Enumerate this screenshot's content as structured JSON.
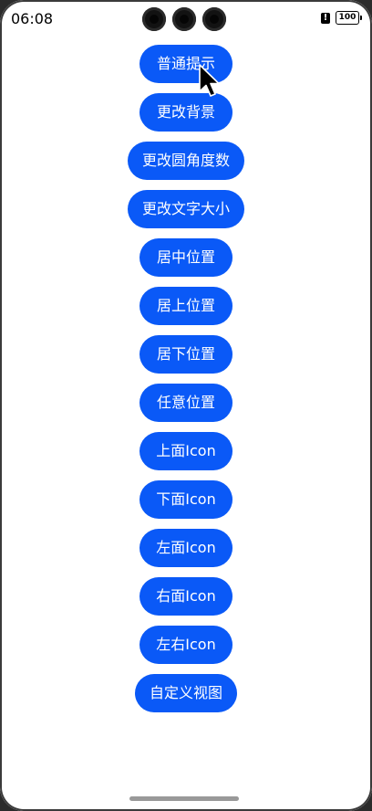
{
  "status_bar": {
    "time": "06:08",
    "battery_level": "100",
    "alert_symbol": "!"
  },
  "buttons": [
    "普通提示",
    "更改背景",
    "更改圆角度数",
    "更改文字大小",
    "居中位置",
    "居上位置",
    "居下位置",
    "任意位置",
    "上面Icon",
    "下面Icon",
    "左面Icon",
    "右面Icon",
    "左右Icon",
    "自定义视图"
  ],
  "colors": {
    "button_bg": "#0a59f7",
    "button_text": "#ffffff",
    "page_bg": "#ffffff"
  },
  "icons": {
    "cursor": "mouse-pointer-icon",
    "battery": "battery-icon",
    "alert": "notification-alert-icon",
    "camera": "camera-cutout-icon"
  }
}
